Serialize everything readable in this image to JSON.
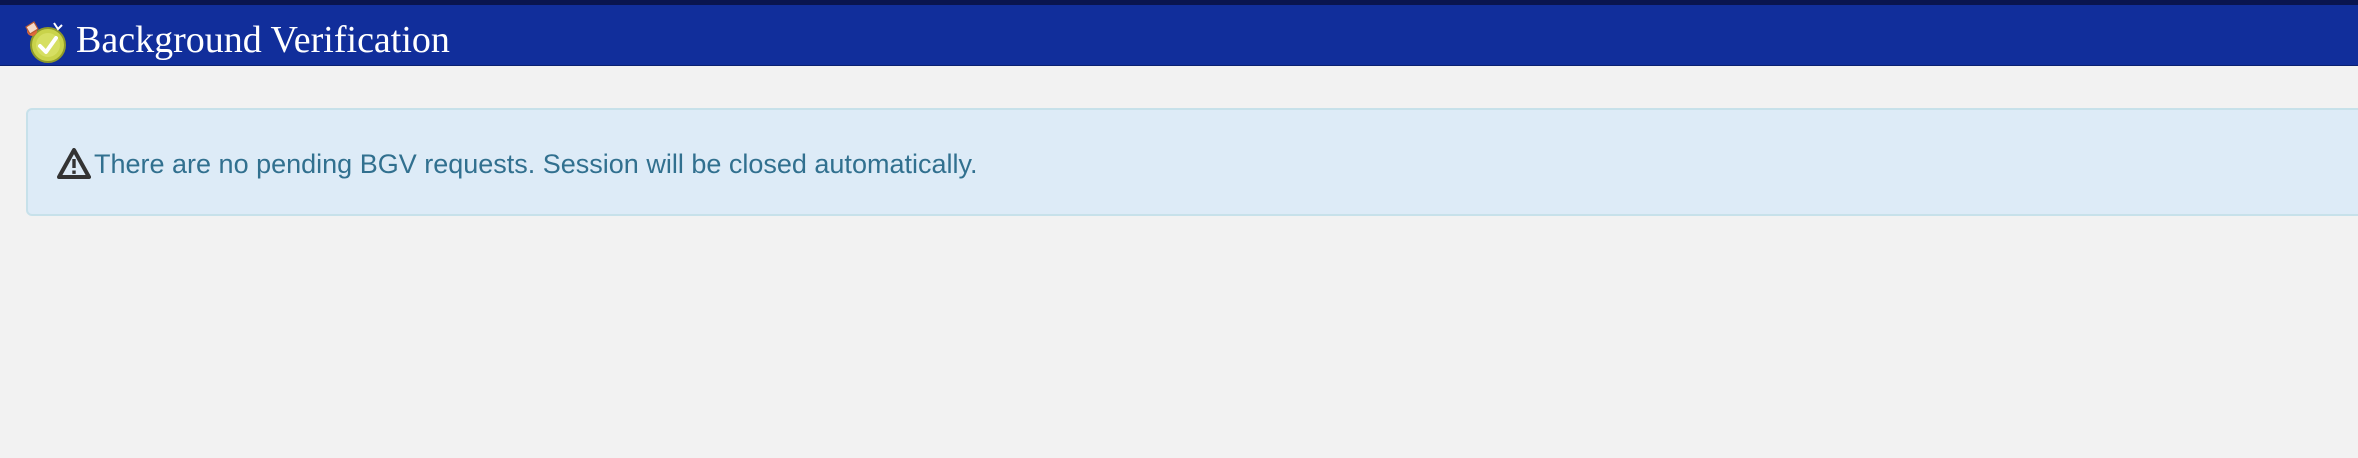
{
  "header": {
    "title": "Background Verification",
    "logo_icon": "verification-badge-icon",
    "background_color": "#112e9b"
  },
  "alert": {
    "icon": "warning-triangle-icon",
    "message": "There are no pending BGV requests. Session will be closed automatically.",
    "background_color": "#ddebf7",
    "text_color": "#31708f"
  }
}
